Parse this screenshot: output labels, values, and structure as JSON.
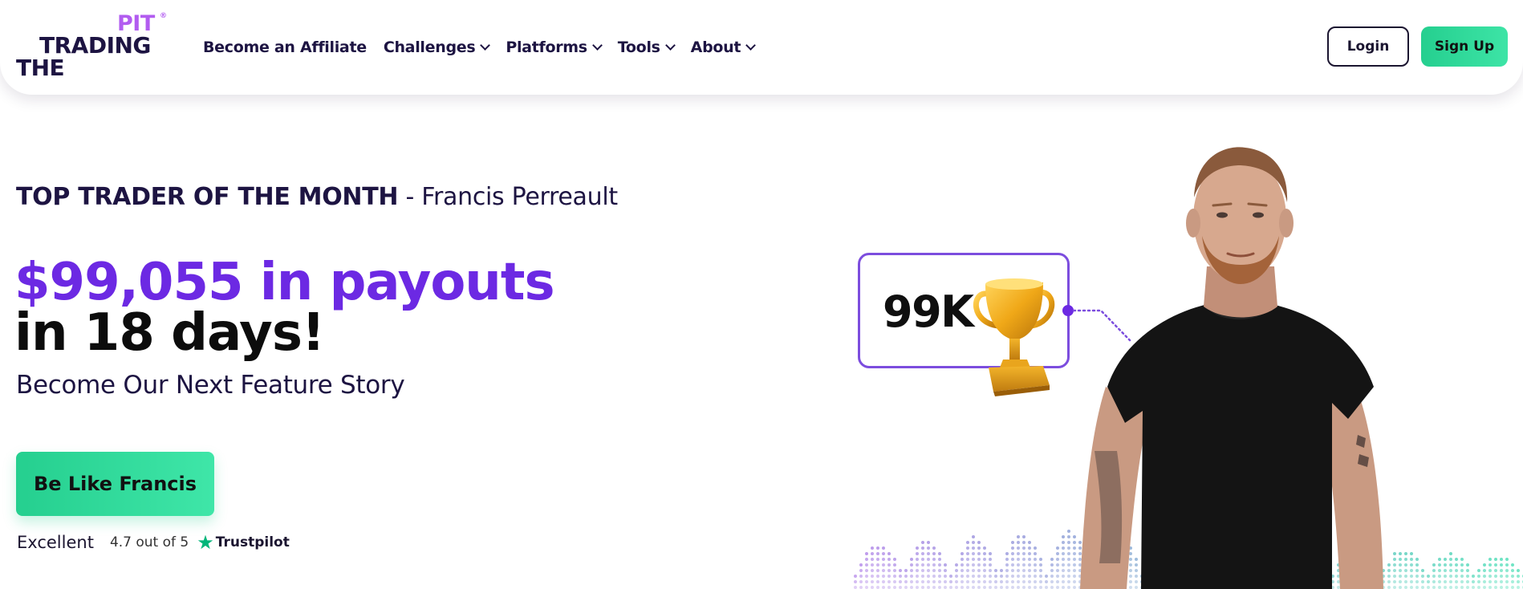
{
  "logo": {
    "line1": "PIT",
    "reg": "®",
    "line2": "TRADING",
    "line3": "THE"
  },
  "nav": {
    "items": [
      {
        "label": "Become an Affiliate",
        "has_dropdown": false
      },
      {
        "label": "Challenges",
        "has_dropdown": true
      },
      {
        "label": "Platforms",
        "has_dropdown": true
      },
      {
        "label": "Tools",
        "has_dropdown": true
      },
      {
        "label": "About",
        "has_dropdown": true
      }
    ],
    "login_label": "Login",
    "signup_label": "Sign Up"
  },
  "hero": {
    "kicker_strong": "TOP TRADER OF THE MONTH",
    "kicker_rest": " - Francis Perreault",
    "headline_line1": "$99,055 in payouts",
    "headline_line2": "in 18 days!",
    "subline": "Become Our Next Feature Story",
    "cta_label": "Be Like Francis"
  },
  "rating": {
    "label": "Excellent",
    "score": "4.7 out of 5",
    "provider": "Trustpilot"
  },
  "badge": {
    "value": "99K"
  },
  "colors": {
    "brand_purple": "#6c29e3",
    "dark_navy": "#1d1442",
    "accent_green": "#25cf8f",
    "trustpilot_green": "#00b67a"
  },
  "icons": [
    "chevron-down-icon",
    "trustpilot-star-icon",
    "trophy-icon"
  ]
}
